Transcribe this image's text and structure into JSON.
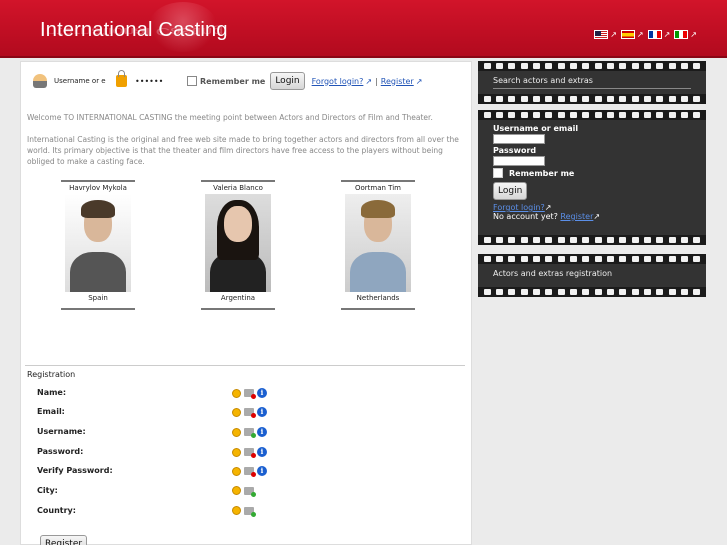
{
  "header": {
    "logo_text": "International Casting",
    "languages": [
      {
        "code": "en",
        "flag": "us-flag-icon"
      },
      {
        "code": "es",
        "flag": "es-flag-icon"
      },
      {
        "code": "fr",
        "flag": "fr-flag-icon"
      },
      {
        "code": "it",
        "flag": "it-flag-icon"
      }
    ],
    "ext_glyph": "↗"
  },
  "login": {
    "username_label": "Username or em:",
    "password_value": "••••••",
    "remember_label": "Remember me",
    "login_button": "Login",
    "forgot_link": "Forgot login?",
    "separator": "|",
    "register_link": "Register"
  },
  "welcome_text": "Welcome TO INTERNATIONAL CASTING the meeting point between Actors and Directors of Film and Theater.",
  "intro_text": "International Casting is the original and free web site made to bring together actors and directors from all over the world. Its primary objective is that the theater and film directors have free access to the players without being obliged to make a casting face.",
  "actors": [
    {
      "name": "Havrylov Mykola",
      "country": "Spain"
    },
    {
      "name": "Valeria Blanco",
      "country": "Argentina"
    },
    {
      "name": "Oortman Tim",
      "country": "Netherlands"
    }
  ],
  "registration": {
    "title": "Registration",
    "fields": [
      {
        "label": "Name:",
        "status": "error",
        "info": true
      },
      {
        "label": "Email:",
        "status": "error",
        "info": true
      },
      {
        "label": "Username:",
        "status": "ok",
        "info": true
      },
      {
        "label": "Password:",
        "status": "error",
        "info": true
      },
      {
        "label": "Verify Password:",
        "status": "error",
        "info": true
      },
      {
        "label": "City:",
        "status": "ok",
        "info": false
      },
      {
        "label": "Country:",
        "status": "ok",
        "info": false
      }
    ],
    "info_glyph": "i",
    "register_button": "Register"
  },
  "sidebar": {
    "search_title": "Search actors and extras",
    "login_box": {
      "username_label": "Username or email",
      "password_label": "Password",
      "remember_label": "Remember me",
      "login_button": "Login",
      "forgot_link": "Forgot login?",
      "no_account_text": "No account yet?",
      "register_link": "Register"
    },
    "registration_title": "Actors and extras registration"
  }
}
